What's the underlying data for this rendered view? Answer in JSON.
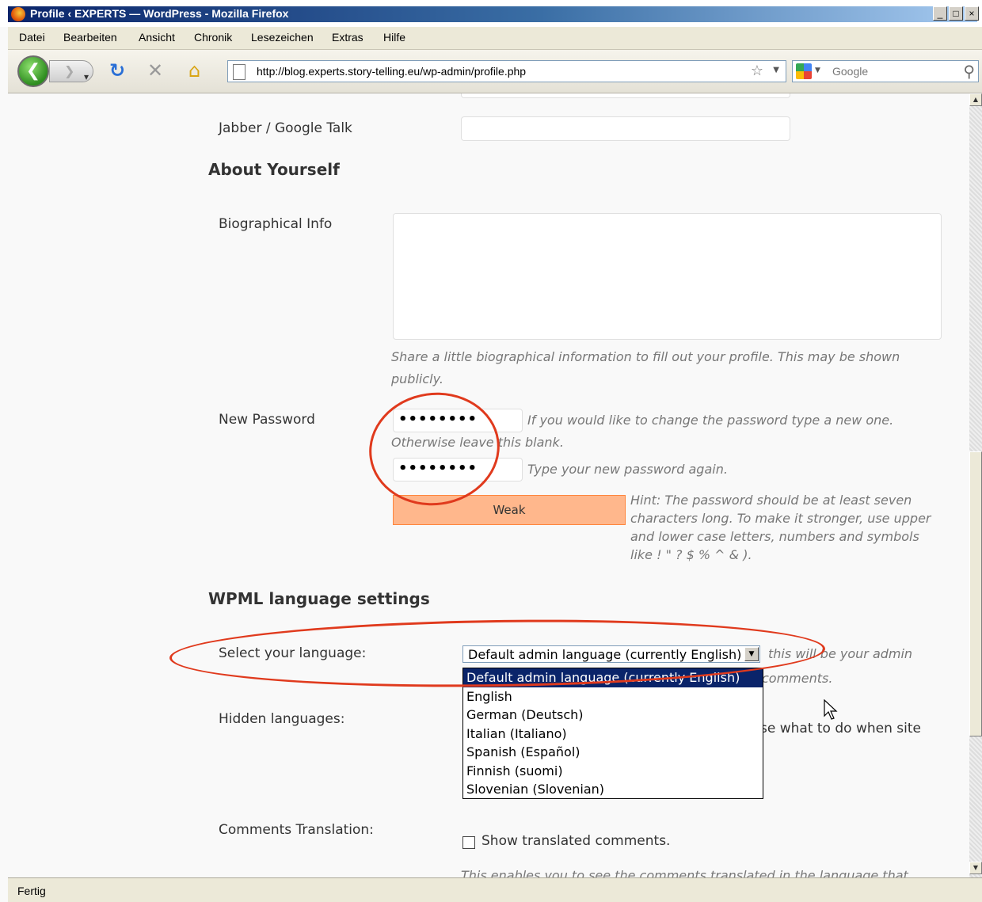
{
  "window": {
    "title": "Profile ‹ EXPERTS — WordPress - Mozilla Firefox",
    "minimize": "_",
    "maximize": "□",
    "close": "×"
  },
  "menu": [
    "Datei",
    "Bearbeiten",
    "Ansicht",
    "Chronik",
    "Lesezeichen",
    "Extras",
    "Hilfe"
  ],
  "nav": {
    "url": "http://blog.experts.story-telling.eu/wp-admin/profile.php",
    "search_placeholder": "Google"
  },
  "profile": {
    "jabber_label": "Jabber / Google Talk",
    "about_heading": "About Yourself",
    "bio_label": "Biographical Info",
    "bio_description": "Share a little biographical information to fill out your profile. This may be shown publicly.",
    "new_password_label": "New Password",
    "password1_value": "••••••••",
    "password1_hint": "If you would like to change the password type a new one. Otherwise leave this blank.",
    "password2_value": "••••••••",
    "password2_hint": "Type your new password again.",
    "strength_label": "Weak",
    "strength_hint": "Hint: The password should be at least seven characters long. To make it stronger, use upper and lower case letters, numbers and symbols like ! \" ? $ % ^ & )."
  },
  "wpml": {
    "heading": "WPML language settings",
    "select_label": "Select your language:",
    "selected_value": "Default admin language (currently English)",
    "select_hint_visible": "this will be your admin",
    "select_hint_2": "comments.",
    "options": [
      "Default admin language (currently English)",
      "English",
      "German (Deutsch)",
      "Italian (Italiano)",
      "Spanish (Español)",
      "Finnish (suomi)",
      "Slovenian (Slovenian)"
    ],
    "hidden_label": "Hidden languages:",
    "hidden_text_visible": "se what to do when site",
    "comments_label": "Comments Translation:",
    "comments_checkbox_label": "Show translated comments.",
    "comments_description": "This enables you to see the comments translated in the language that"
  },
  "status": {
    "text": "Fertig"
  },
  "colors": {
    "annotation": "#e03a1d",
    "strength_weak": "#ffb78c",
    "selected_option": "#0a246a"
  }
}
